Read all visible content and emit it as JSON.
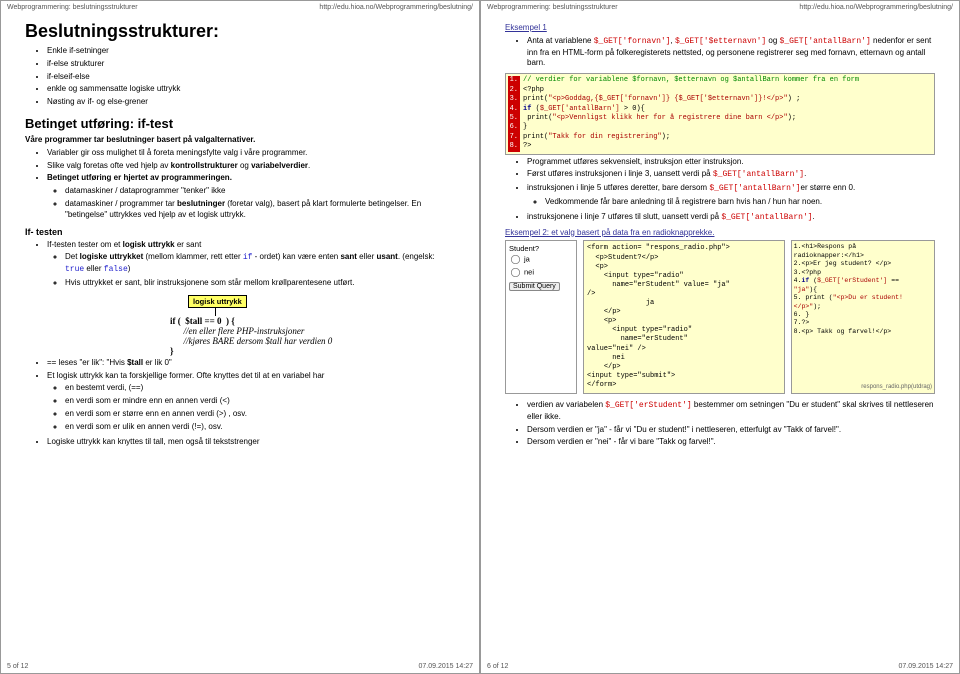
{
  "hdr_title": "Webprogrammering: beslutningsstrukturer",
  "hdr_url": "http://edu.hioa.no/Webprogrammering/beslutning/",
  "page5": "5 of 12",
  "page6": "6 of 12",
  "timestamp": "07.09.2015 14:27",
  "left": {
    "h1": "Beslutningsstrukturer:",
    "list1": [
      "Enkle if-setninger",
      "if-else strukturer",
      "if-elseif-else",
      "enkle og sammensatte logiske uttrykk",
      "Nøsting av if- og else-grener"
    ],
    "h2": "Betinget utføring: if-test",
    "intro": "Våre programmer tar beslutninger basert på valgalternativer.",
    "list2a": "Variabler gir oss mulighet til å foreta meningsfylte valg i våre programmer.",
    "list2b_pre": "Slike valg foretas ofte ved hjelp av ",
    "list2b_b1": "kontrollstrukturer",
    "list2b_mid": " og ",
    "list2b_b2": "variabelverdier",
    "list2b_post": ".",
    "list2c": "Betinget utføring er hjertet av programmeringen.",
    "list2c1": "datamaskiner / dataprogrammer \"tenker\" ikke",
    "list2c2_pre": "datamaskiner / programmer tar ",
    "list2c2_b": "beslutninger",
    "list2c2_post": " (foretar valg), basert på klart formulerte betingelser. En \"betingelse\" uttrykkes ved hjelp av et logisk uttrykk.",
    "h3": "If- testen",
    "if1_pre": "If-testen tester om et ",
    "if1_b": "logisk uttrykk",
    "if1_post": " er sant",
    "if1a_pre": "Det ",
    "if1a_b": "logiske uttrykket",
    "if1a_mid": " (mellom klammer, rett etter ",
    "if1a_kw": "if",
    "if1a_mid2": " - ordet) kan være enten ",
    "if1a_b2": "sant",
    "if1a_mid3": " eller ",
    "if1a_b3": "usant",
    "if1a_post": ". (engelsk: ",
    "if1a_true": "true",
    "if1a_or": " eller ",
    "if1a_false": "false",
    "if1a_end": ")",
    "if1b": "Hvis uttrykket er sant, blir instruksjonene som står mellom krøllparentesene utført.",
    "diag_label": "logisk uttrykk",
    "diag_if": "if (  $tall == 0  ) {",
    "diag_c1": "//en eller flere PHP-instruksjoner",
    "diag_c2": "//kjøres BARE dersom $tall har verdien 0",
    "diag_close": "}",
    "eqline_pre": "== leses \"er lik\": \"Hvis ",
    "eqline_b": "$tall",
    "eqline_post": " er lik 0\"",
    "log_intro": "Et logisk uttrykk kan ta forskjellige former. Ofte knyttes det til at en variabel har",
    "log_a": "en bestemt verdi, (==)",
    "log_b": "en verdi som er mindre enn en annen verdi (<)",
    "log_c": "en verdi som er større enn en annen verdi (>) , osv.",
    "log_d": "en verdi som er ulik en annen verdi (!=), osv.",
    "log_out": "Logiske uttrykk kan knyttes til tall, men også til tekststrenger"
  },
  "right": {
    "eks1": "Eksempel 1",
    "p1_pre": "Anta at variablene ",
    "v1": "$_GET['fornavn']",
    "sep1": ", ",
    "v2": "$_GET['$etternavn']",
    "sep2": " og ",
    "v3": "$_GET['antallBarn']",
    "p1_post": " nedenfor er sent inn fra en HTML-form på folkeregisterets nettsted, og personene registrerer seg med fornavn, etternavn og antall barn.",
    "code1": [
      "// verdier for variablene $fornavn, $etternavn og $antallBarn kommer fra en form",
      "<?php",
      "print(\"<p>Goddag,{$_GET['fornavn']} {$_GET['$etternavn']}!</p>\") ;",
      "if ($_GET['antallBarn'] > 0){",
      "    print(\"<p>Vennligst klikk her for å registrere dine barn </p>\");",
      "}",
      "print(\"Takk for din registrering\");",
      "?>"
    ],
    "b1": "Programmet utføres sekvensielt, instruksjon etter instruksjon.",
    "b2_pre": "Først utføres instruksjonen i linje 3, uansett verdi på ",
    "b2_v": "$_GET['antallBarn']",
    "b2_post": ".",
    "b3_pre": "instruksjonen i linje 5 utføres deretter, bare dersom ",
    "b3_v": "$_GET['antallBarn']",
    "b3_post": "er større enn 0.",
    "b3a": "Vedkommende får bare anledning til å registrere barn hvis han / hun har noen.",
    "b4_pre": "instruksjonene i linje 7 utføres til slutt, uansett verdi på ",
    "b4_v": "$_GET['antallBarn']",
    "b4_post": ".",
    "eks2": "Eksempel 2: et valg basert på data fra en radioknapprekke.",
    "render_q": "Student?",
    "render_ja": "ja",
    "render_nei": "nei",
    "render_submit": "Submit Query",
    "formcode": "<form action= \"respons_radio.php\">\n  <p>Student?</p>\n  <p>\n    <input type=\"radio\"\n      name=\"erStudent\" value= \"ja\"\n/>\n              ja\n    </p>\n    <p>\n      <input type=\"radio\"\n        name=\"erStudent\"\nvalue=\"nei\" />\n      nei\n    </p>\n<input type=\"submit\">\n</form>",
    "resp_lines": [
      "<h1>Respons på",
      "radioknapper:</h1>",
      "<p>Er jeg student? </p>",
      "<?php",
      "if ($_GET['erStudent'] ==",
      "\"ja\"){",
      "  print (\"<p>Du er student!",
      "</p>\");",
      "}",
      "?>",
      "<p> Takk og farvel!</p>"
    ],
    "resp_utdrag": "respons_radio.php(utdrag)",
    "c1_pre": "verdien av variabelen ",
    "c1_v": "$_GET['erStudent']",
    "c1_post": " bestemmer om setningen \"Du er student\" skal skrives til nettleseren eller ikke.",
    "c2": "Dersom verdien er \"ja\" - får vi \"Du er student!\" i nettleseren, etterfulgt av \"Takk of farvel!\".",
    "c3": "Dersom verdien er \"nei\" - får vi bare \"Takk og farvel!\"."
  }
}
